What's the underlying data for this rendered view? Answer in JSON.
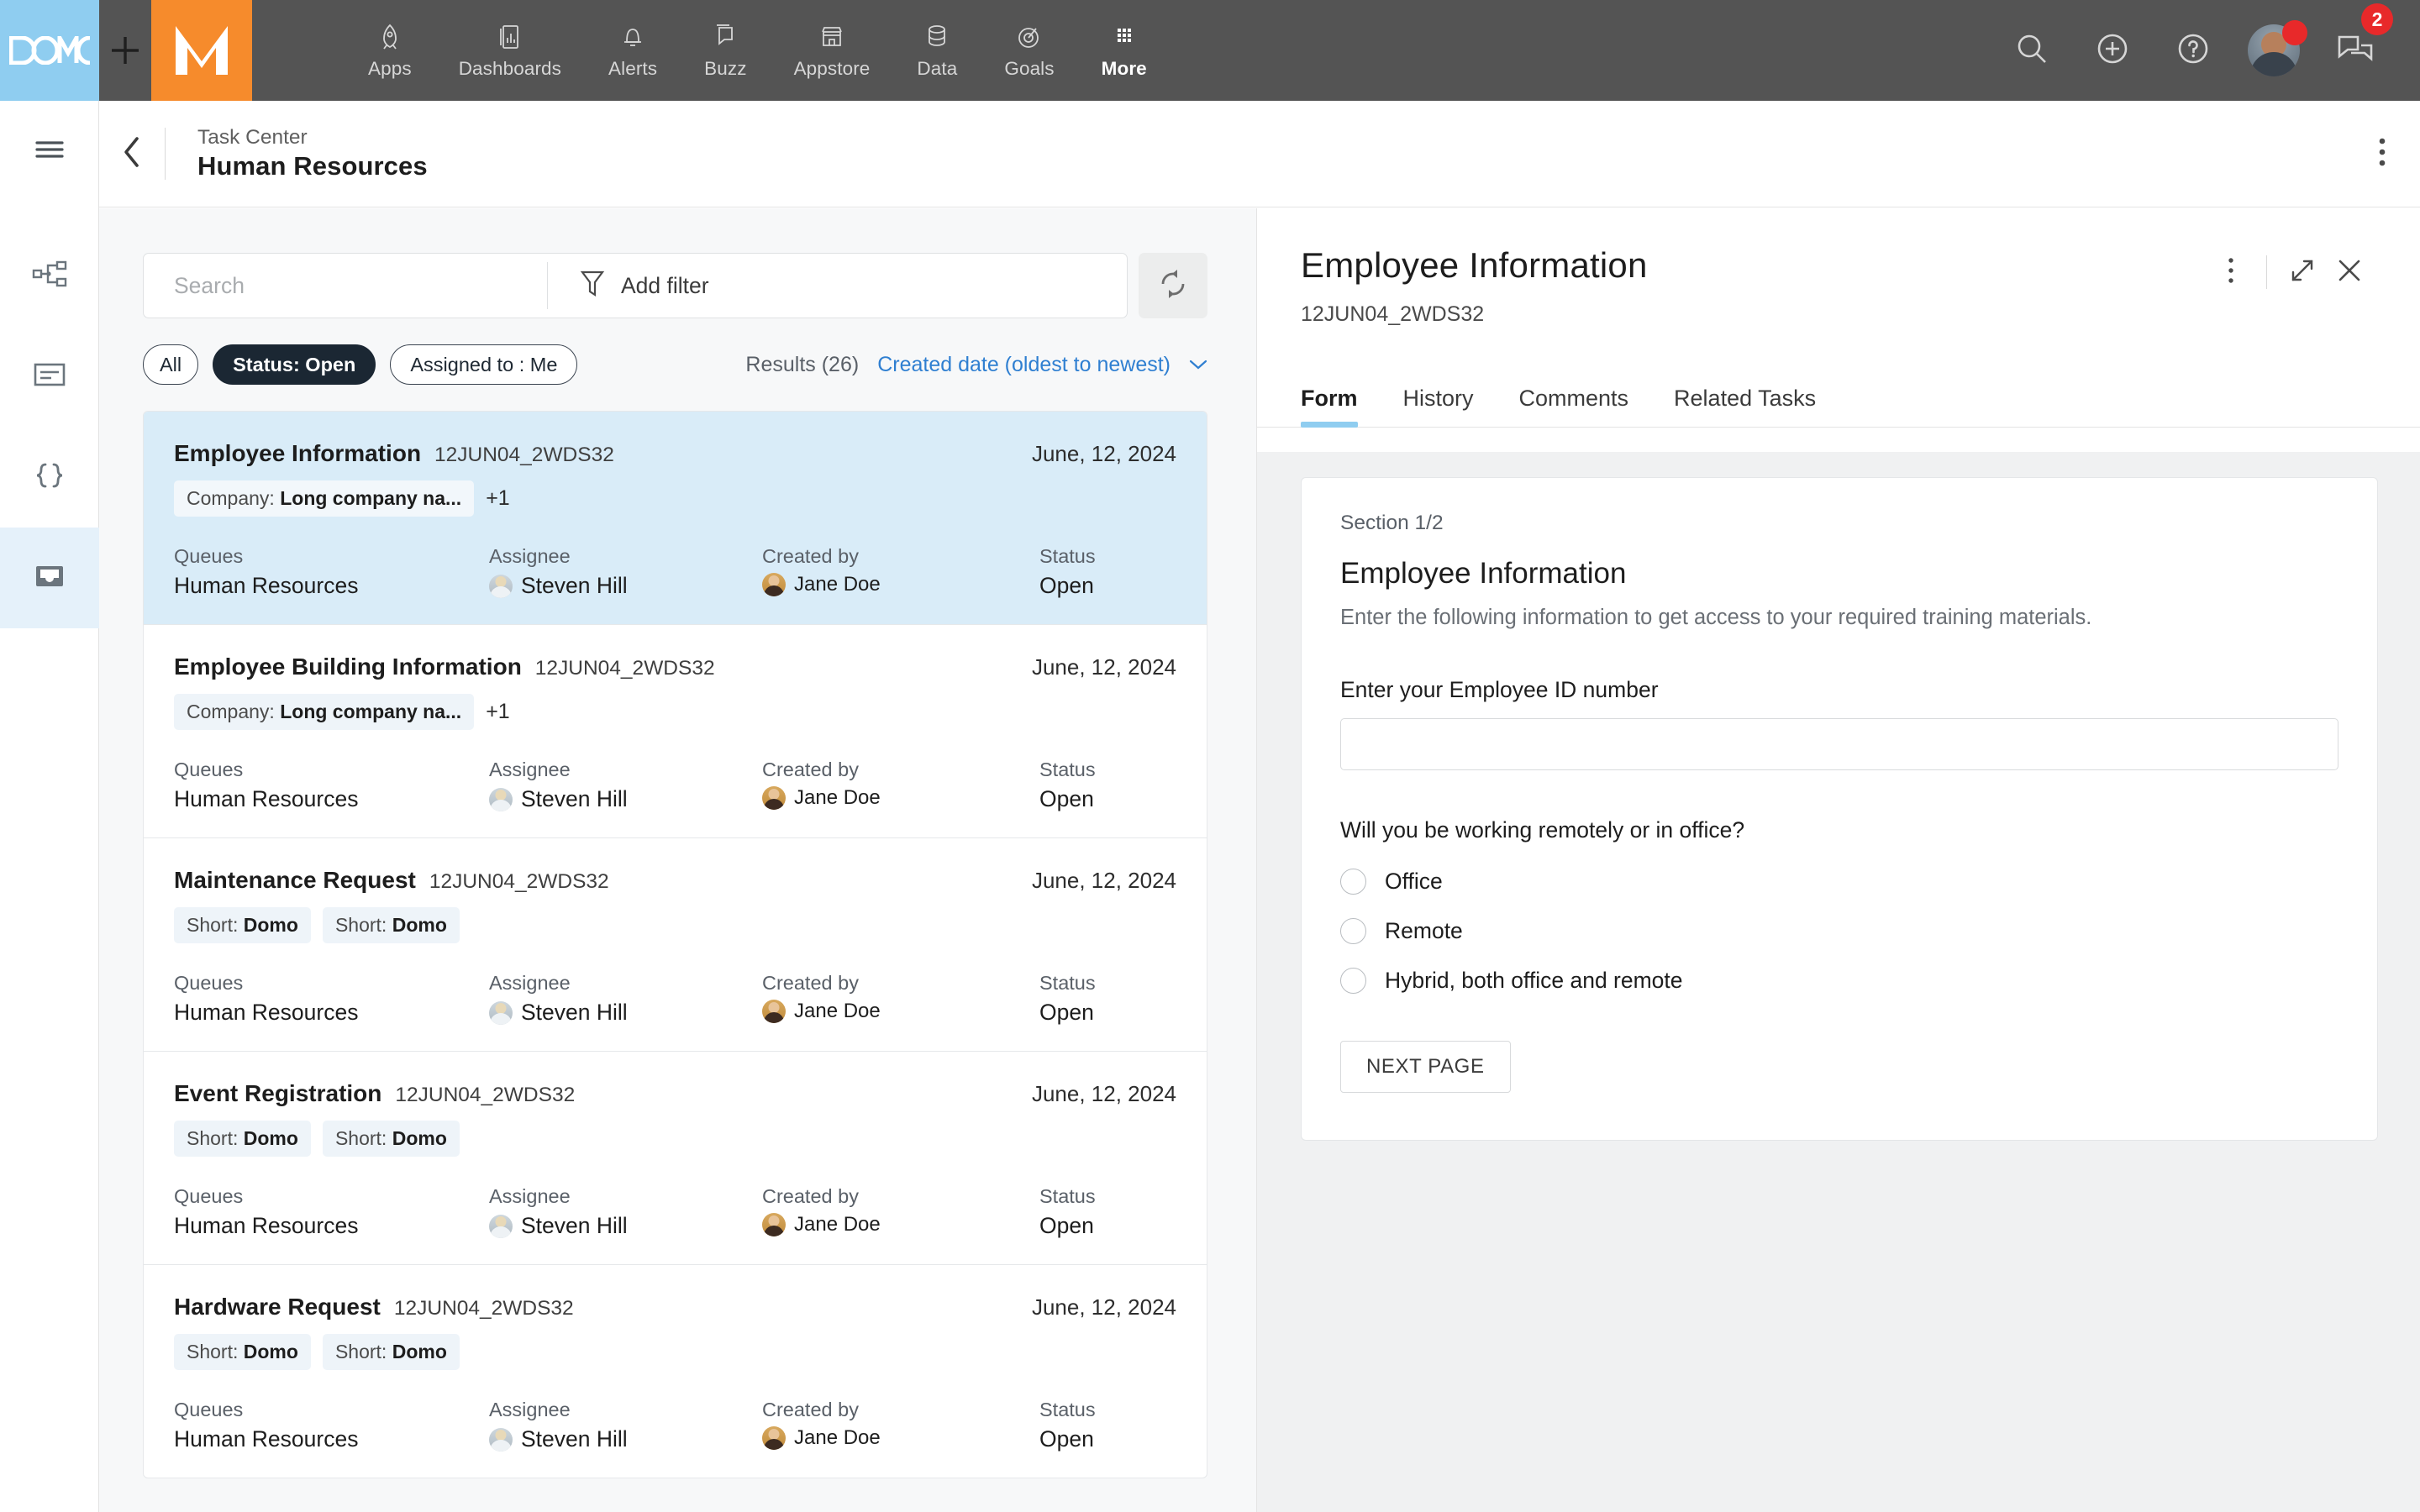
{
  "topnav": {
    "brand_domo": "DOMO",
    "brand_plus": "+",
    "brand_m": "M",
    "items": [
      {
        "label": "Apps",
        "icon": "rocket-icon"
      },
      {
        "label": "Dashboards",
        "icon": "dashboard-icon"
      },
      {
        "label": "Alerts",
        "icon": "bell-icon"
      },
      {
        "label": "Buzz",
        "icon": "chat-icon"
      },
      {
        "label": "Appstore",
        "icon": "store-icon"
      },
      {
        "label": "Data",
        "icon": "database-icon"
      },
      {
        "label": "Goals",
        "icon": "target-icon"
      },
      {
        "label": "More",
        "icon": "grid-icon"
      }
    ],
    "right": {
      "search": "search-icon",
      "add": "plus-circle-icon",
      "help": "question-circle-icon",
      "avatar": "user-avatar",
      "messages": "messages-icon",
      "message_count": "2"
    }
  },
  "rail": {
    "items": [
      {
        "icon": "hamburger-menu-icon",
        "active": false
      },
      {
        "icon": "workflow-icon",
        "active": false
      },
      {
        "icon": "form-icon",
        "active": false
      },
      {
        "icon": "code-braces-icon",
        "active": false
      },
      {
        "icon": "inbox-icon",
        "active": true
      }
    ]
  },
  "pageheader": {
    "back_icon": "chevron-left-icon",
    "breadcrumb": "Task Center",
    "title": "Human Resources",
    "overflow_icon": "more-vertical-icon"
  },
  "toolbar": {
    "search_placeholder": "Search",
    "search_value": "",
    "filter_label": "Add filter",
    "filter_icon": "funnel-icon",
    "refresh_icon": "refresh-icon",
    "chips": [
      {
        "label": "All",
        "active": false
      },
      {
        "label": "Status: Open",
        "active": true
      },
      {
        "label": "Assigned to : Me",
        "active": false
      }
    ],
    "results_label": "Results (26)",
    "sort_label": "Created date (oldest to newest)",
    "sort_caret_icon": "chevron-down-icon"
  },
  "list": {
    "meta_labels": {
      "queues": "Queues",
      "assignee": "Assignee",
      "created_by": "Created by",
      "status": "Status"
    },
    "cards": [
      {
        "title": "Employee Information",
        "id": "12JUN04_2WDS32",
        "date": "June, 12, 2024",
        "tags": [
          {
            "key": "Company:",
            "value": "Long company na..."
          }
        ],
        "tag_more": "+1",
        "queue": "Human Resources",
        "assignee": "Steven Hill",
        "created_by": "Jane Doe",
        "status": "Open",
        "selected": true
      },
      {
        "title": "Employee Building Information",
        "id": "12JUN04_2WDS32",
        "date": "June, 12, 2024",
        "tags": [
          {
            "key": "Company:",
            "value": "Long company na..."
          }
        ],
        "tag_more": "+1",
        "queue": "Human Resources",
        "assignee": "Steven Hill",
        "created_by": "Jane Doe",
        "status": "Open",
        "selected": false
      },
      {
        "title": "Maintenance Request",
        "id": "12JUN04_2WDS32",
        "date": "June, 12, 2024",
        "tags": [
          {
            "key": "Short:",
            "value": "Domo"
          },
          {
            "key": "Short:",
            "value": "Domo"
          }
        ],
        "tag_more": "",
        "queue": "Human Resources",
        "assignee": "Steven Hill",
        "created_by": "Jane Doe",
        "status": "Open",
        "selected": false
      },
      {
        "title": "Event Registration",
        "id": "12JUN04_2WDS32",
        "date": "June, 12, 2024",
        "tags": [
          {
            "key": "Short:",
            "value": "Domo"
          },
          {
            "key": "Short:",
            "value": "Domo"
          }
        ],
        "tag_more": "",
        "queue": "Human Resources",
        "assignee": "Steven Hill",
        "created_by": "Jane Doe",
        "status": "Open",
        "selected": false
      },
      {
        "title": "Hardware Request",
        "id": "12JUN04_2WDS32",
        "date": "June, 12, 2024",
        "tags": [
          {
            "key": "Short:",
            "value": "Domo"
          },
          {
            "key": "Short:",
            "value": "Domo"
          }
        ],
        "tag_more": "",
        "queue": "Human Resources",
        "assignee": "Steven Hill",
        "created_by": "Jane Doe",
        "status": "Open",
        "selected": false
      }
    ]
  },
  "detail": {
    "title": "Employee Information",
    "subtitle": "12JUN04_2WDS32",
    "overflow_icon": "more-vertical-icon",
    "expand_icon": "expand-icon",
    "close_icon": "close-icon",
    "tabs": [
      {
        "label": "Form",
        "active": true
      },
      {
        "label": "History",
        "active": false
      },
      {
        "label": "Comments",
        "active": false
      },
      {
        "label": "Related Tasks",
        "active": false
      }
    ],
    "form": {
      "section": "Section 1/2",
      "heading": "Employee Information",
      "description": "Enter the following information to get access to your required training materials.",
      "field_label": "Enter your Employee ID number",
      "field_value": "",
      "field_placeholder": "",
      "question": "Will you be working remotely or in office?",
      "options": [
        {
          "label": "Office",
          "selected": false
        },
        {
          "label": "Remote",
          "selected": false
        },
        {
          "label": "Hybrid, both office and remote",
          "selected": false
        }
      ],
      "next_label": "NEXT PAGE"
    }
  },
  "colors": {
    "nav_bg": "#545454",
    "brand_blue": "#8fcdf0",
    "brand_orange": "#f68b2c",
    "selected_card": "#d9ecf8",
    "accent_link": "#2f7fd1",
    "badge_red": "#e8292a",
    "chip_dark": "#1b2733"
  }
}
